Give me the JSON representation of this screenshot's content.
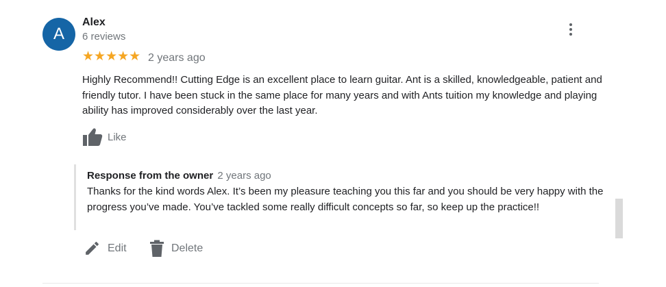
{
  "review": {
    "avatar_letter": "A",
    "reviewer_name": "Alex",
    "review_count": "6 reviews",
    "stars": "★★★★★",
    "rating": 5,
    "date": "2 years ago",
    "text": "Highly Recommend!! Cutting Edge is an excellent place to learn guitar. Ant is  a skilled, knowledgeable, patient and friendly tutor. I have been stuck in the same place for many years and with Ants tuition my knowledge and playing ability has improved considerably over the last year.",
    "like_label": "Like",
    "more_icon": "more-vert-icon"
  },
  "response": {
    "title": "Response from the owner",
    "date": "2 years ago",
    "text": "Thanks for the kind words Alex. It’s been my pleasure teaching you this far and you should be very happy with the progress you’ve made. You’ve tackled some really difficult concepts so far, so keep up the practice!!"
  },
  "actions": {
    "edit_label": "Edit",
    "delete_label": "Delete"
  },
  "colors": {
    "avatar_bg": "#1565a6",
    "star": "#f5a623",
    "muted_text": "#70757a",
    "icon": "#5f6368"
  }
}
